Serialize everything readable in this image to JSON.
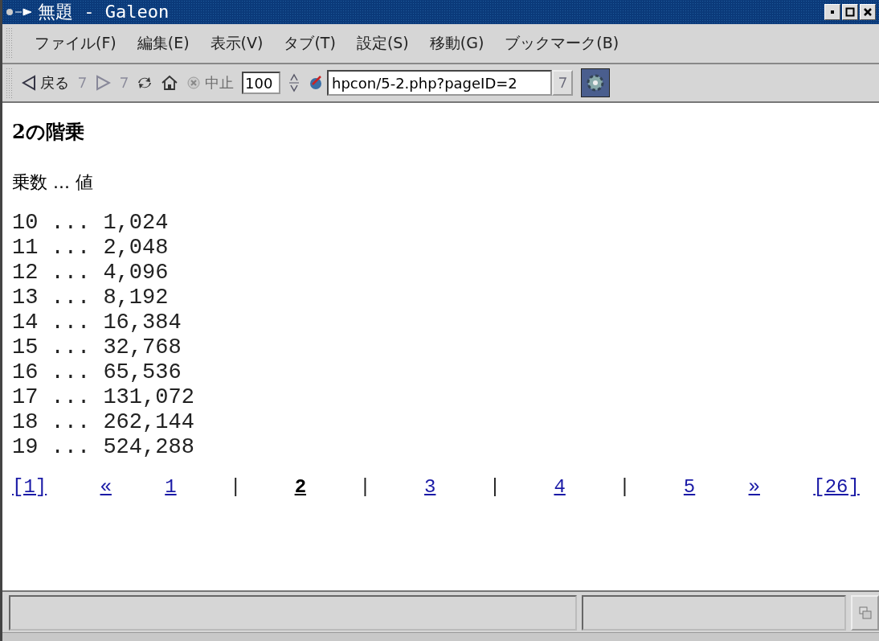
{
  "window": {
    "title": "無題 - Galeon"
  },
  "menu": [
    "ファイル(F)",
    "編集(E)",
    "表示(V)",
    "タブ(T)",
    "設定(S)",
    "移動(G)",
    "ブックマーク(B)"
  ],
  "toolbar": {
    "back_label": "戻る",
    "stop_label": "中止",
    "stop_disabled": true,
    "zoom": "100",
    "url": "hpcon/5-2.php?pageID=2"
  },
  "page": {
    "heading": "2の階乗",
    "header": "乗数 ... 値",
    "rows": [
      "10 ... 1,024",
      "11 ... 2,048",
      "12 ... 4,096",
      "13 ... 8,192",
      "14 ... 16,384",
      "15 ... 32,768",
      "16 ... 65,536",
      "17 ... 131,072",
      "18 ... 262,144",
      "19 ... 524,288"
    ],
    "pager": [
      {
        "kind": "link",
        "label": "[1]"
      },
      {
        "kind": "link",
        "label": "«"
      },
      {
        "kind": "page",
        "label": "1",
        "selected": false
      },
      {
        "kind": "sep",
        "label": "|"
      },
      {
        "kind": "page",
        "label": "2",
        "selected": true
      },
      {
        "kind": "sep",
        "label": "|"
      },
      {
        "kind": "page",
        "label": "3",
        "selected": false
      },
      {
        "kind": "sep",
        "label": "|"
      },
      {
        "kind": "page",
        "label": "4",
        "selected": false
      },
      {
        "kind": "sep",
        "label": "|"
      },
      {
        "kind": "page",
        "label": "5",
        "selected": false
      },
      {
        "kind": "link",
        "label": "»"
      },
      {
        "kind": "link",
        "label": "[26]"
      }
    ]
  }
}
